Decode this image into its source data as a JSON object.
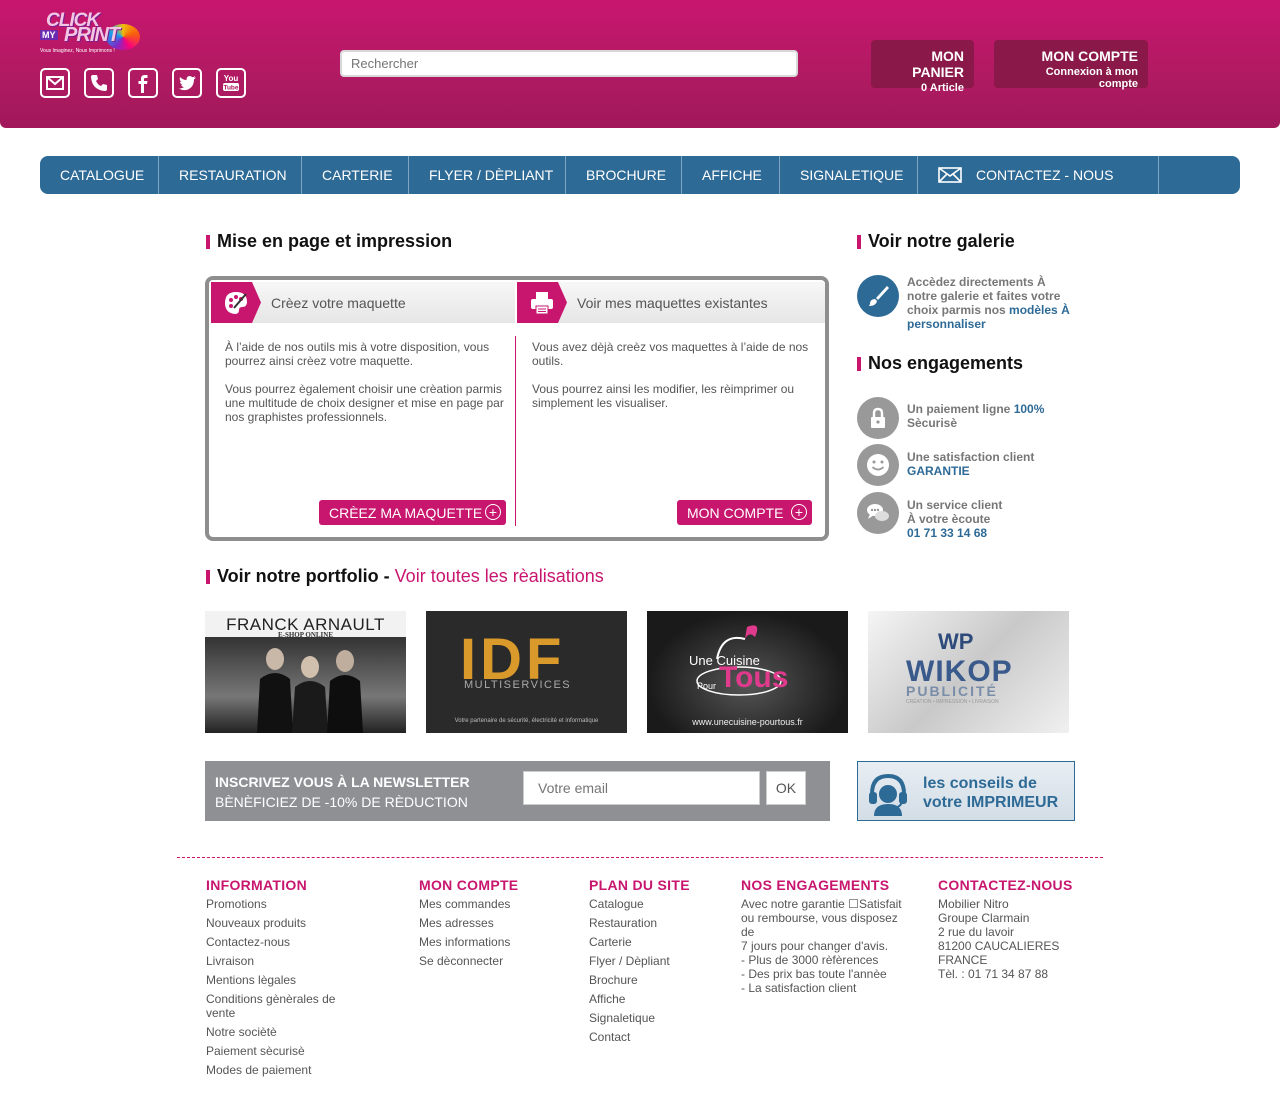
{
  "header": {
    "logo": {
      "line1": "CLICK",
      "line2": "MY",
      "line3": "PRINT",
      "tagline": "Vous Imaginez, Nous Imprimons !"
    },
    "socials": [
      {
        "name": "email-icon"
      },
      {
        "name": "phone-icon"
      },
      {
        "name": "facebook-icon"
      },
      {
        "name": "twitter-icon"
      },
      {
        "name": "youtube-icon"
      }
    ],
    "search_placeholder": "Rechercher",
    "panier": {
      "title": "MON PANIER",
      "sub": "0 Article"
    },
    "compte": {
      "title": "MON COMPTE",
      "sub": "Connexion à mon compte"
    }
  },
  "nav": [
    "CATALOGUE",
    "RESTAURATION",
    "CARTERIE",
    "FLYER / DÈPLIANT",
    "BROCHURE",
    "AFFICHE",
    "SIGNALETIQUE",
    "CONTACTEZ - NOUS"
  ],
  "main": {
    "title": "Mise en page et impression",
    "left": {
      "heading": "Crèez votre maquette",
      "p1": "À l’aide de nos outils mis à votre disposition, vous pourrez ainsi crèez votre maquette.",
      "p2": "Vous pourrez ègalement choisir une crèation parmis une multitude de choix designer et mise en page par nos graphistes professionnels.",
      "button": "CRÈEZ MA MAQUETTE"
    },
    "right": {
      "heading": "Voir mes maquettes existantes",
      "p1": "Vous avez dèjà creèz vos maquettes à l’aide de nos outils.",
      "p2": "Vous pourrez ainsi les modifier, les rèimprimer ou simplement les visualiser.",
      "button": "MON COMPTE"
    }
  },
  "sidebar": {
    "gallery_title": "Voir notre galerie",
    "gallery_text": "Accèdez directements À notre galerie et faites votre choix parmis nos",
    "gallery_link": "modèles À personnaliser",
    "engagements_title": "Nos engagements",
    "eng1": {
      "text": "Un paiement ligne",
      "strong": "100%",
      "text2": "Sècurisè"
    },
    "eng2": {
      "text": "Une satisfaction client",
      "strong": "GARANTIE"
    },
    "eng3": {
      "text": "Un service client",
      "text2": "À votre ècoute",
      "strong": "01 71 33 14 68"
    }
  },
  "portfolio": {
    "title": "Voir notre portfolio -",
    "link": "Voir toutes les rèalisations",
    "items": [
      {
        "title": "FRANCK ARNAULT",
        "sub": "E-SHOP ONLINE"
      },
      {
        "title": "IDF",
        "sub": "MULTISERVICES",
        "caption": "Votre partenaire de sécurité, électricité et informatique"
      },
      {
        "title": "Tous",
        "pre": "Une Cuisine",
        "pour": "Pour",
        "url": "www.unecuisine-pourtous.fr"
      },
      {
        "title": "WIKOP",
        "logo": "WP",
        "sub": "PUBLICITÉ",
        "caption": "CRÉATION • IMPRESSION • LIVRAISON"
      }
    ]
  },
  "newsletter": {
    "line1": "INSCRIVEZ VOUS À LA NEWSLETTER",
    "line2": "BÈNÈFICIEZ DE -10% DE RÈDUCTION",
    "placeholder": "Votre email",
    "ok": "OK"
  },
  "conseils": {
    "line1": "les conseils de",
    "line2": "votre IMPRIMEUR"
  },
  "footer": {
    "information": {
      "title": "INFORMATION",
      "links": [
        "Promotions",
        "Nouveaux produits",
        "Contactez-nous",
        "Livraison",
        "Mentions lègales",
        "Conditions gènèrales de vente",
        "Notre sociètè",
        "Paiement sècurisè",
        "Modes de paiement"
      ]
    },
    "compte": {
      "title": "MON COMPTE",
      "links": [
        "Mes commandes",
        "Mes adresses",
        "Mes informations",
        "Se dèconnecter"
      ]
    },
    "plan": {
      "title": "PLAN DU SITE",
      "links": [
        "Catalogue",
        "Restauration",
        "Carterie",
        "Flyer / Dèpliant",
        "Brochure",
        "Affiche",
        "Signaletique",
        "Contact"
      ]
    },
    "engagements": {
      "title": "NOS ENGAGEMENTS",
      "lines": [
        "Avec notre garantie ☐Satisfait ou rembourse, vous disposez de",
        "7 jours pour changer d'avis.",
        "- Plus de 3000 rèfèrences",
        "- Des prix bas toute l'annèe",
        "- La satisfaction client"
      ]
    },
    "contact": {
      "title": "CONTACTEZ-NOUS",
      "lines": [
        "Mobilier Nitro",
        "Groupe Clarmain",
        "2 rue du lavoir",
        "81200 CAUCALIERES",
        "FRANCE",
        "Tèl. : 01 71 34 87 88"
      ]
    }
  }
}
